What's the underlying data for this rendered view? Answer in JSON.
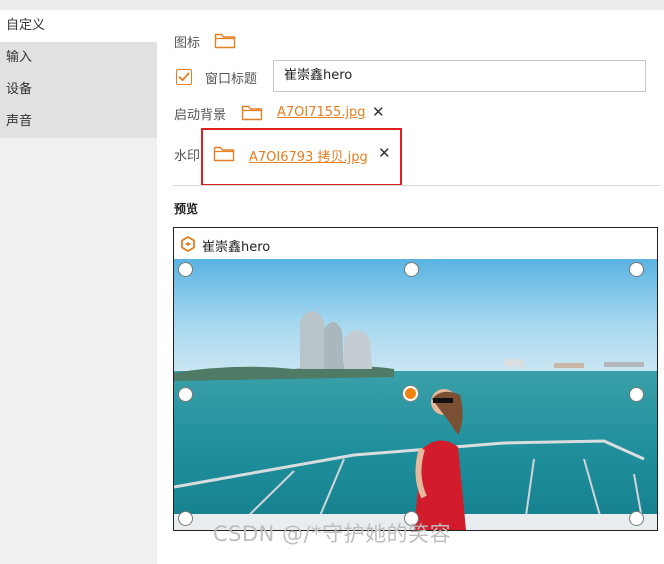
{
  "sidebar": {
    "items": [
      {
        "label": "自定义"
      },
      {
        "label": "输入"
      },
      {
        "label": "设备"
      },
      {
        "label": "声音"
      }
    ]
  },
  "form": {
    "icon_label": "图标",
    "window_title_label": "窗口标题",
    "window_title_checked": true,
    "window_title_value": "崔崇鑫hero",
    "splash_label": "启动背景",
    "splash_file": "A7OI7155.jpg",
    "watermark_label": "水印",
    "watermark_file": "A7OI6793 拷贝.jpg"
  },
  "preview": {
    "label": "预览",
    "window_title": "崔崇鑫hero"
  },
  "overlay": {
    "watermark_text": "CSDN @/*守护她的笑容"
  },
  "colors": {
    "accent": "#e67e22",
    "highlight_box": "#e02020"
  }
}
